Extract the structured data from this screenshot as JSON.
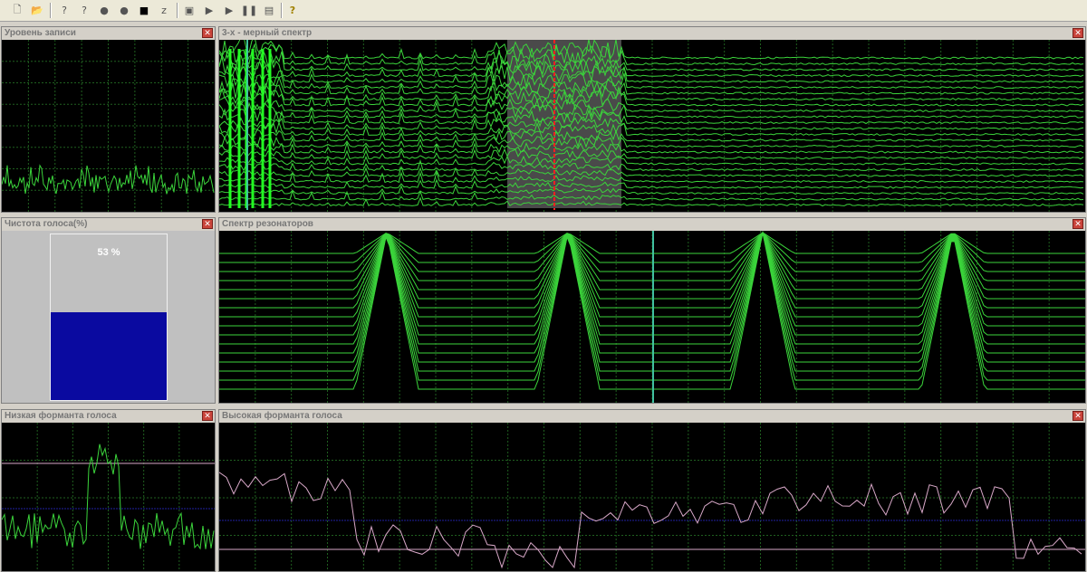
{
  "toolbar": {
    "buttons": [
      {
        "name": "new-file-icon",
        "glyph": "🗋"
      },
      {
        "name": "open-folder-icon",
        "glyph": "📂"
      },
      {
        "name": "help-person-icon",
        "glyph": "?"
      },
      {
        "name": "help-person-2-icon",
        "glyph": "?"
      },
      {
        "name": "record-dot-icon",
        "glyph": "●"
      },
      {
        "name": "record-dot-2-icon",
        "glyph": "●"
      },
      {
        "name": "stop-icon",
        "glyph": "■"
      },
      {
        "name": "zoom-icon",
        "glyph": "z"
      },
      {
        "name": "export-icon",
        "glyph": "▣"
      },
      {
        "name": "play-icon",
        "glyph": "▶"
      },
      {
        "name": "play-2-icon",
        "glyph": "▶"
      },
      {
        "name": "pause-icon",
        "glyph": "❚❚"
      },
      {
        "name": "document-icon",
        "glyph": "▤"
      },
      {
        "name": "help-icon",
        "glyph": "?"
      }
    ]
  },
  "panels": {
    "recording_level": {
      "title": "Уровень записи"
    },
    "spectrum_3d": {
      "title": "3-х - мерный  спектр"
    },
    "voice_purity": {
      "title": "Чистота голоса(%)",
      "value_text": "53 %",
      "percent": 53
    },
    "resonator_spectrum": {
      "title": "Спектр резонаторов"
    },
    "low_formant": {
      "title": "Низкая форманта голоса"
    },
    "high_formant": {
      "title": "Высокая форманта голоса"
    }
  },
  "colors": {
    "trace_green": "#3bd43b",
    "bright_green": "#22ff22",
    "grid_green": "#1f5f1f",
    "cursor_red": "#ff2020",
    "cursor_teal": "#40c0a0",
    "pink_line": "#d8a8c8",
    "blue_line": "#2020a0",
    "purity_fill": "#0a0aa0",
    "purity_bg": "#c0c0c0"
  }
}
